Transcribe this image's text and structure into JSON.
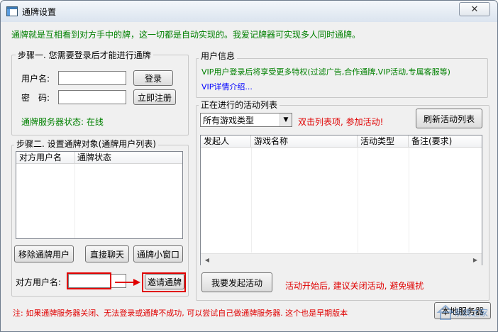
{
  "window": {
    "title": "通牌设置",
    "close_symbol": "✕"
  },
  "intro": "通牌就是互相看到对方手中的牌，这一切都是自动实现的。我爱记牌器可实现多人同时通牌。",
  "step1": {
    "legend": "步骤一. 您需要登录后才能进行通牌",
    "username_label": "用户名:",
    "username_value": "",
    "password_label": "密　码:",
    "password_value": "",
    "login_button": "登录",
    "register_button": "立即注册",
    "server_status": "通牌服务器状态: 在线"
  },
  "user_info": {
    "legend": "用户信息",
    "vip_text": "VIP用户登录后将享受更多特权(过滤广告,合作通牌,VIP活动,专属客服等)",
    "vip_link": "VIP详情介绍..."
  },
  "step2": {
    "legend": "步骤二. 设置通牌对象(通牌用户列表)",
    "columns": [
      "对方用户名",
      "通牌状态"
    ],
    "remove_button": "移除通牌用户",
    "chat_button": "直接聊天",
    "mini_window_button": "通牌小窗口",
    "opponent_label": "对方用户名:",
    "opponent_value": "",
    "invite_button": "邀请通牌"
  },
  "activities": {
    "legend": "正在进行的活动列表",
    "filter_selected": "所有游戏类型",
    "hint": "双击列表项, 参加活动!",
    "refresh_button": "刷新活动列表",
    "columns": [
      "发起人",
      "游戏名称",
      "活动类型",
      "备注(要求)"
    ],
    "start_button": "我要发起活动",
    "start_hint": "活动开始后, 建议关闭活动, 避免骚扰"
  },
  "footer_note": "注: 如果通牌服务器关闭、无法登录或通牌不成功, 可以尝试自己做通牌服务器. 这个也是早期版本",
  "bottom_right_button": "本地服务器",
  "watermark": "系统之家",
  "colors": {
    "green": "#008000",
    "red": "#e00000",
    "blue": "#0000ff",
    "annotation": "#e00000"
  }
}
